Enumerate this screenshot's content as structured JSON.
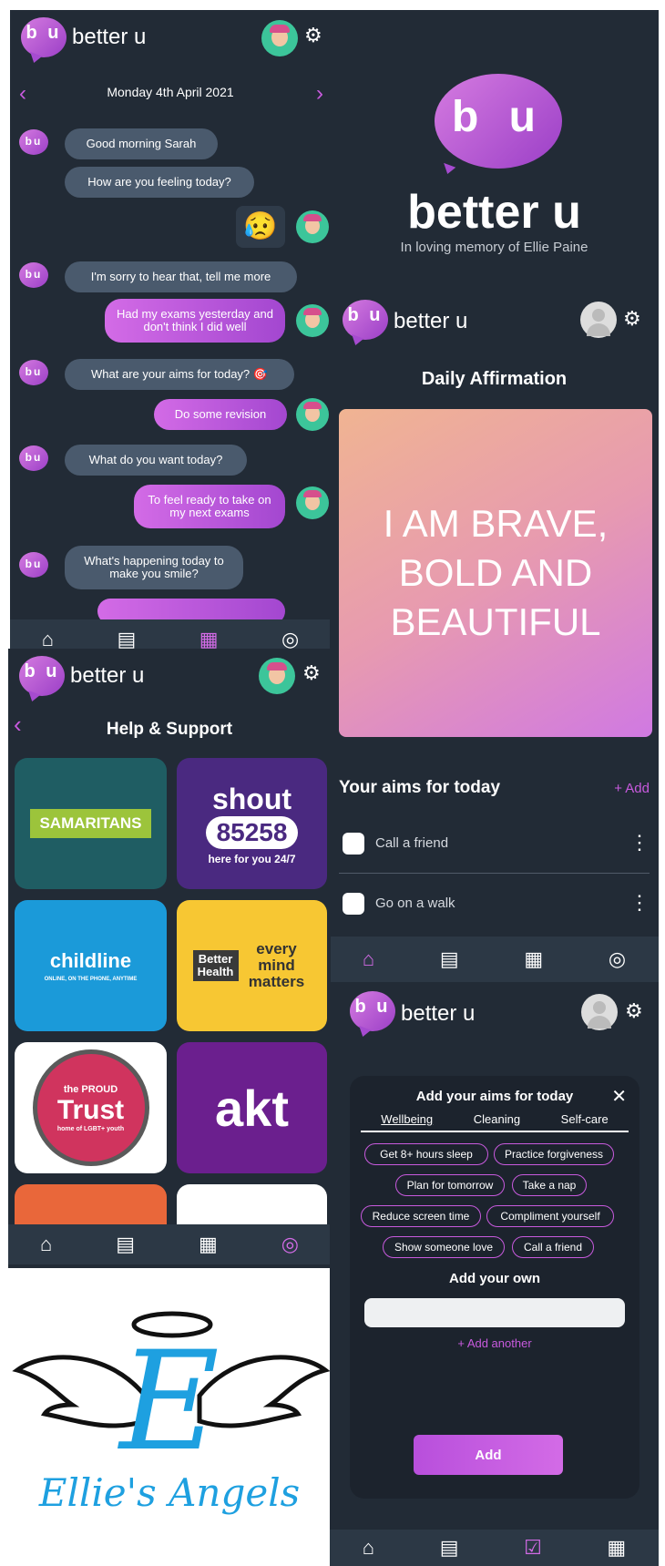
{
  "brand": {
    "name": "better u",
    "logo_letters": "b u",
    "memorial": "In loving memory of Ellie Paine"
  },
  "icons": {
    "gear": "gear-icon",
    "home": "home-icon",
    "journal": "journal-icon",
    "calendar": "calendar-icon",
    "support": "lifebuoy-icon",
    "close": "close-icon",
    "more": "more-vert-icon"
  },
  "colors": {
    "bg": "#222b36",
    "accent": "#c85ade",
    "bubble_bot": "#4a5a6d"
  },
  "chat": {
    "date": "Monday 4th  April 2021",
    "prev_glyph": "‹",
    "next_glyph": "›",
    "emoji": "😥",
    "msgs": {
      "m1": "Good morning Sarah",
      "m2": "How are you feeling today?",
      "m3": "I'm sorry to hear that, tell me more",
      "m4": "Had my exams yesterday and don't think I did well",
      "m5": "What are your aims for today? 🎯",
      "m6": "Do some revision",
      "m7": "What do you want today?",
      "m8": "To feel ready to take on my next exams",
      "m9": "What's happening today to make you smile?"
    }
  },
  "support": {
    "back_glyph": "‹",
    "title": "Help & Support",
    "tiles": {
      "samaritans": "SAMARITANS",
      "shout": "shout",
      "shout_number": "85258",
      "shout_tag": "here for you 24/7",
      "childline": "childline",
      "childline_tag": "ONLINE, ON THE PHONE, ANYTIME",
      "better_health": "Better Health",
      "every_mind": "every mind matters",
      "proud": "the PROUD",
      "trust": "Trust",
      "trust_tag": "home of LGBT+ youth",
      "akt": "akt"
    }
  },
  "angels": {
    "letter": "E",
    "caption": "Ellie's Angels"
  },
  "affirmation": {
    "title": "Daily Affirmation",
    "text": "I AM BRAVE, BOLD AND BEAUTIFUL",
    "aims_title": "Your aims for today",
    "add_label": "+ Add",
    "aims": [
      "Call a friend",
      "Go on a walk"
    ]
  },
  "add_aims": {
    "title": "Add your aims for today",
    "tabs": [
      "Wellbeing",
      "Cleaning",
      "Self-care"
    ],
    "chips": [
      "Get 8+ hours sleep",
      "Practice forgiveness",
      "Plan for tomorrow",
      "Take a nap",
      "Reduce screen time",
      "Compliment yourself",
      "Show someone love",
      "Call a friend"
    ],
    "own_title": "Add your own",
    "own_placeholder": "",
    "add_another": "+ Add another",
    "button": "Add"
  }
}
